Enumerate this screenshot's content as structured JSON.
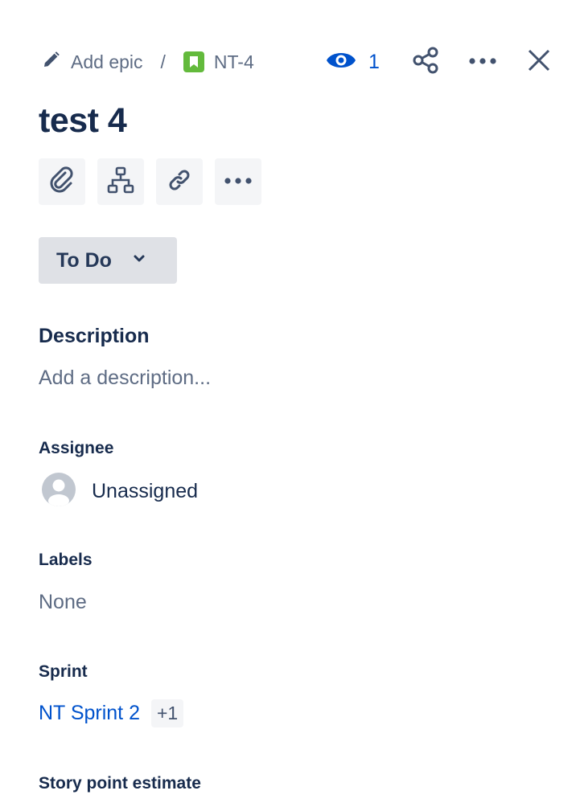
{
  "breadcrumb": {
    "epic_label": "Add epic",
    "separator": "/",
    "issue_key": "NT-4"
  },
  "header_actions": {
    "watchers_count": "1",
    "icons": [
      "eye-icon",
      "share-icon",
      "more-icon",
      "close-icon"
    ]
  },
  "issue": {
    "title": "test 4"
  },
  "quick_actions": {
    "icons": [
      "attachment-icon",
      "child-issue-icon",
      "link-icon",
      "more-icon"
    ]
  },
  "status": {
    "label": "To Do"
  },
  "description": {
    "heading": "Description",
    "placeholder": "Add a description..."
  },
  "fields": {
    "assignee": {
      "label": "Assignee",
      "value": "Unassigned"
    },
    "labels": {
      "label": "Labels",
      "value": "None"
    },
    "sprint": {
      "label": "Sprint",
      "value": "NT Sprint 2",
      "extra": "+1"
    },
    "story_points": {
      "label": "Story point estimate"
    }
  },
  "colors": {
    "accent": "#0052CC",
    "story": "#63BA3C",
    "text": "#172B4D",
    "muted": "#5E6C84"
  }
}
